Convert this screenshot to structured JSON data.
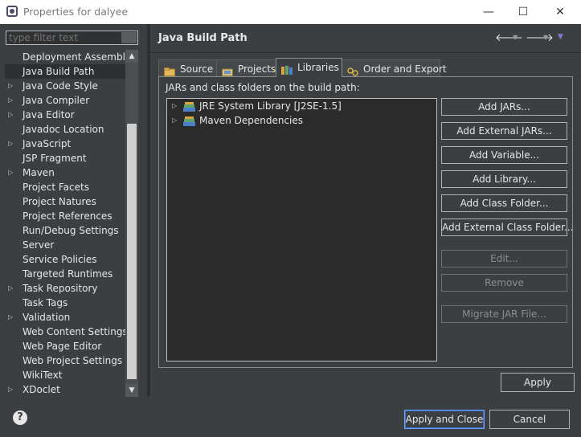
{
  "window": {
    "title": "Properties for dalyee",
    "minimize_glyph": "—",
    "maximize_glyph": "☐",
    "close_glyph": "✕"
  },
  "left": {
    "filter_placeholder": "type filter text",
    "items": [
      {
        "label": "Deployment Assembly",
        "expandable": false,
        "selected": false
      },
      {
        "label": "Java Build Path",
        "expandable": false,
        "selected": true
      },
      {
        "label": "Java Code Style",
        "expandable": true,
        "selected": false
      },
      {
        "label": "Java Compiler",
        "expandable": true,
        "selected": false
      },
      {
        "label": "Java Editor",
        "expandable": true,
        "selected": false
      },
      {
        "label": "Javadoc Location",
        "expandable": false,
        "selected": false
      },
      {
        "label": "JavaScript",
        "expandable": true,
        "selected": false
      },
      {
        "label": "JSP Fragment",
        "expandable": false,
        "selected": false
      },
      {
        "label": "Maven",
        "expandable": true,
        "selected": false
      },
      {
        "label": "Project Facets",
        "expandable": false,
        "selected": false
      },
      {
        "label": "Project Natures",
        "expandable": false,
        "selected": false
      },
      {
        "label": "Project References",
        "expandable": false,
        "selected": false
      },
      {
        "label": "Run/Debug Settings",
        "expandable": false,
        "selected": false
      },
      {
        "label": "Server",
        "expandable": false,
        "selected": false
      },
      {
        "label": "Service Policies",
        "expandable": false,
        "selected": false
      },
      {
        "label": "Targeted Runtimes",
        "expandable": false,
        "selected": false
      },
      {
        "label": "Task Repository",
        "expandable": true,
        "selected": false
      },
      {
        "label": "Task Tags",
        "expandable": false,
        "selected": false
      },
      {
        "label": "Validation",
        "expandable": true,
        "selected": false
      },
      {
        "label": "Web Content Settings",
        "expandable": false,
        "selected": false
      },
      {
        "label": "Web Page Editor",
        "expandable": false,
        "selected": false
      },
      {
        "label": "Web Project Settings",
        "expandable": false,
        "selected": false
      },
      {
        "label": "WikiText",
        "expandable": false,
        "selected": false
      },
      {
        "label": "XDoclet",
        "expandable": true,
        "selected": false
      }
    ]
  },
  "page": {
    "title": "Java Build Path",
    "tabs": [
      {
        "label": "Source",
        "icon": "source-folder-icon",
        "active": false
      },
      {
        "label": "Projects",
        "icon": "projects-icon",
        "active": false
      },
      {
        "label": "Libraries",
        "icon": "libraries-icon",
        "active": true
      },
      {
        "label": "Order and Export",
        "icon": "order-export-icon",
        "active": false
      }
    ],
    "list_label": "JARs and class folders on the build path:",
    "entries": [
      {
        "label": "JRE System Library [J2SE-1.5]",
        "icon": "library-icon"
      },
      {
        "label": "Maven Dependencies",
        "icon": "library-icon"
      }
    ],
    "buttons": [
      {
        "label": "Add JARs...",
        "enabled": true
      },
      {
        "label": "Add External JARs...",
        "enabled": true
      },
      {
        "label": "Add Variable...",
        "enabled": true
      },
      {
        "label": "Add Library...",
        "enabled": true
      },
      {
        "label": "Add Class Folder...",
        "enabled": true
      },
      {
        "label": "Add External Class Folder...",
        "enabled": true
      },
      {
        "label": "Edit...",
        "enabled": false
      },
      {
        "label": "Remove",
        "enabled": false
      },
      {
        "label": "Migrate JAR File...",
        "enabled": false
      }
    ],
    "apply_label": "Apply"
  },
  "footer": {
    "help_glyph": "?",
    "apply_close_label": "Apply and Close",
    "cancel_label": "Cancel"
  },
  "colors": {
    "background": "#3b3f42",
    "list_background": "#2b2b2b",
    "text": "#e6e6e6",
    "disabled_text": "#8a8d90",
    "default_button_border": "#6fa3ff"
  }
}
